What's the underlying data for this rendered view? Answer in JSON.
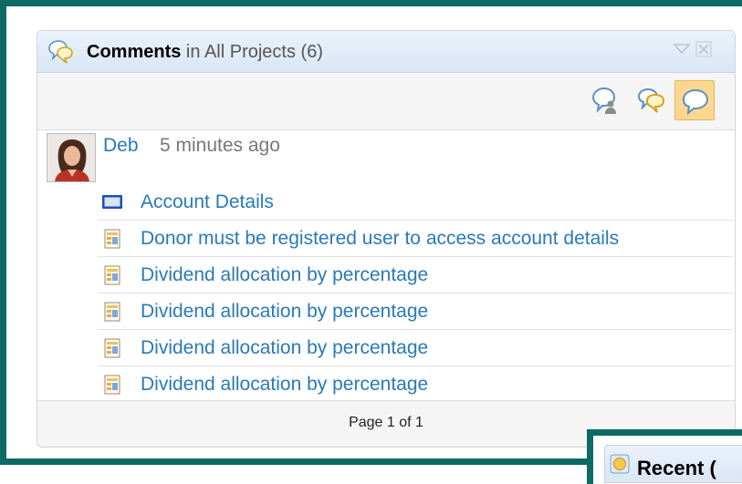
{
  "widget": {
    "title": "Comments",
    "subtitle": "in All Projects (6)",
    "icons": {
      "title": "comments-icon",
      "collapse": "collapse-triangle-icon",
      "close": "close-icon"
    }
  },
  "toolbar": {
    "buttons": [
      {
        "icon": "user-comments-filter-icon",
        "active": false
      },
      {
        "icon": "project-comments-filter-icon",
        "active": false
      },
      {
        "icon": "all-comments-filter-icon",
        "active": true
      }
    ]
  },
  "author": {
    "name": "Deb",
    "time": "5 minutes ago",
    "avatar_icon": "user-avatar"
  },
  "items": [
    {
      "label": "Account Details",
      "icon": "screen-icon"
    },
    {
      "label": "Donor must be registered user to access account details",
      "icon": "requirement-doc-icon"
    },
    {
      "label": "Dividend allocation by percentage",
      "icon": "requirement-doc-icon"
    },
    {
      "label": "Dividend allocation by percentage",
      "icon": "requirement-doc-icon"
    },
    {
      "label": "Dividend allocation by percentage",
      "icon": "requirement-doc-icon"
    },
    {
      "label": "Dividend allocation by percentage",
      "icon": "requirement-doc-icon"
    }
  ],
  "pager": {
    "text": "Page 1 of 1"
  },
  "next_widget": {
    "title": "Recent (",
    "icon": "recent-icon"
  },
  "colors": {
    "frame": "#0b6b64",
    "link": "#2a7ab7",
    "active_button": "#fbd88f"
  }
}
